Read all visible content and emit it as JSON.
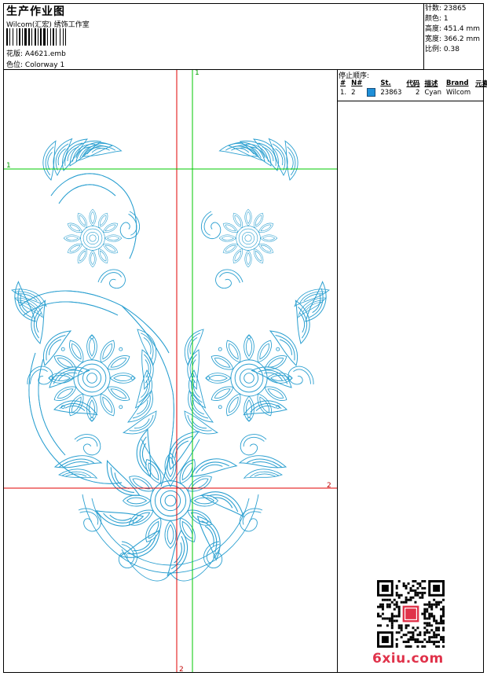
{
  "header": {
    "title": "生产作业图",
    "company": "Wilcom(汇宏) 绣饰工作室",
    "design_label": "花版:",
    "design_file": "A4621.emb",
    "colorway_label": "色位:",
    "colorway": "Colorway 1"
  },
  "stats": {
    "stitches": "针数: 23865",
    "colors": "颜色: 1",
    "height": "高度: 451.4 mm",
    "width": "宽度: 366.2 mm",
    "scale": "比例: 0.38"
  },
  "stop_sequence": {
    "title": "停止顺序:",
    "columns": [
      "#",
      "N#",
      "St.",
      "代码",
      "描述",
      "Brand",
      "元素"
    ],
    "rows": [
      {
        "num": "1.",
        "n": "2",
        "stitches": "23863",
        "code": "2",
        "description": "Cyan",
        "brand": "Wilcom",
        "element": "",
        "color": "#1e8fd8"
      }
    ]
  },
  "guides": {
    "top_label": "1",
    "left_label": "1",
    "right_label": "2",
    "bottom_label": "2"
  },
  "colors": {
    "embroidery": "#2a9fd0",
    "guide_red": "#e00000",
    "guide_green": "#00c800",
    "watermark": "#e0324a"
  },
  "watermark": {
    "text": "6xiu.com"
  }
}
